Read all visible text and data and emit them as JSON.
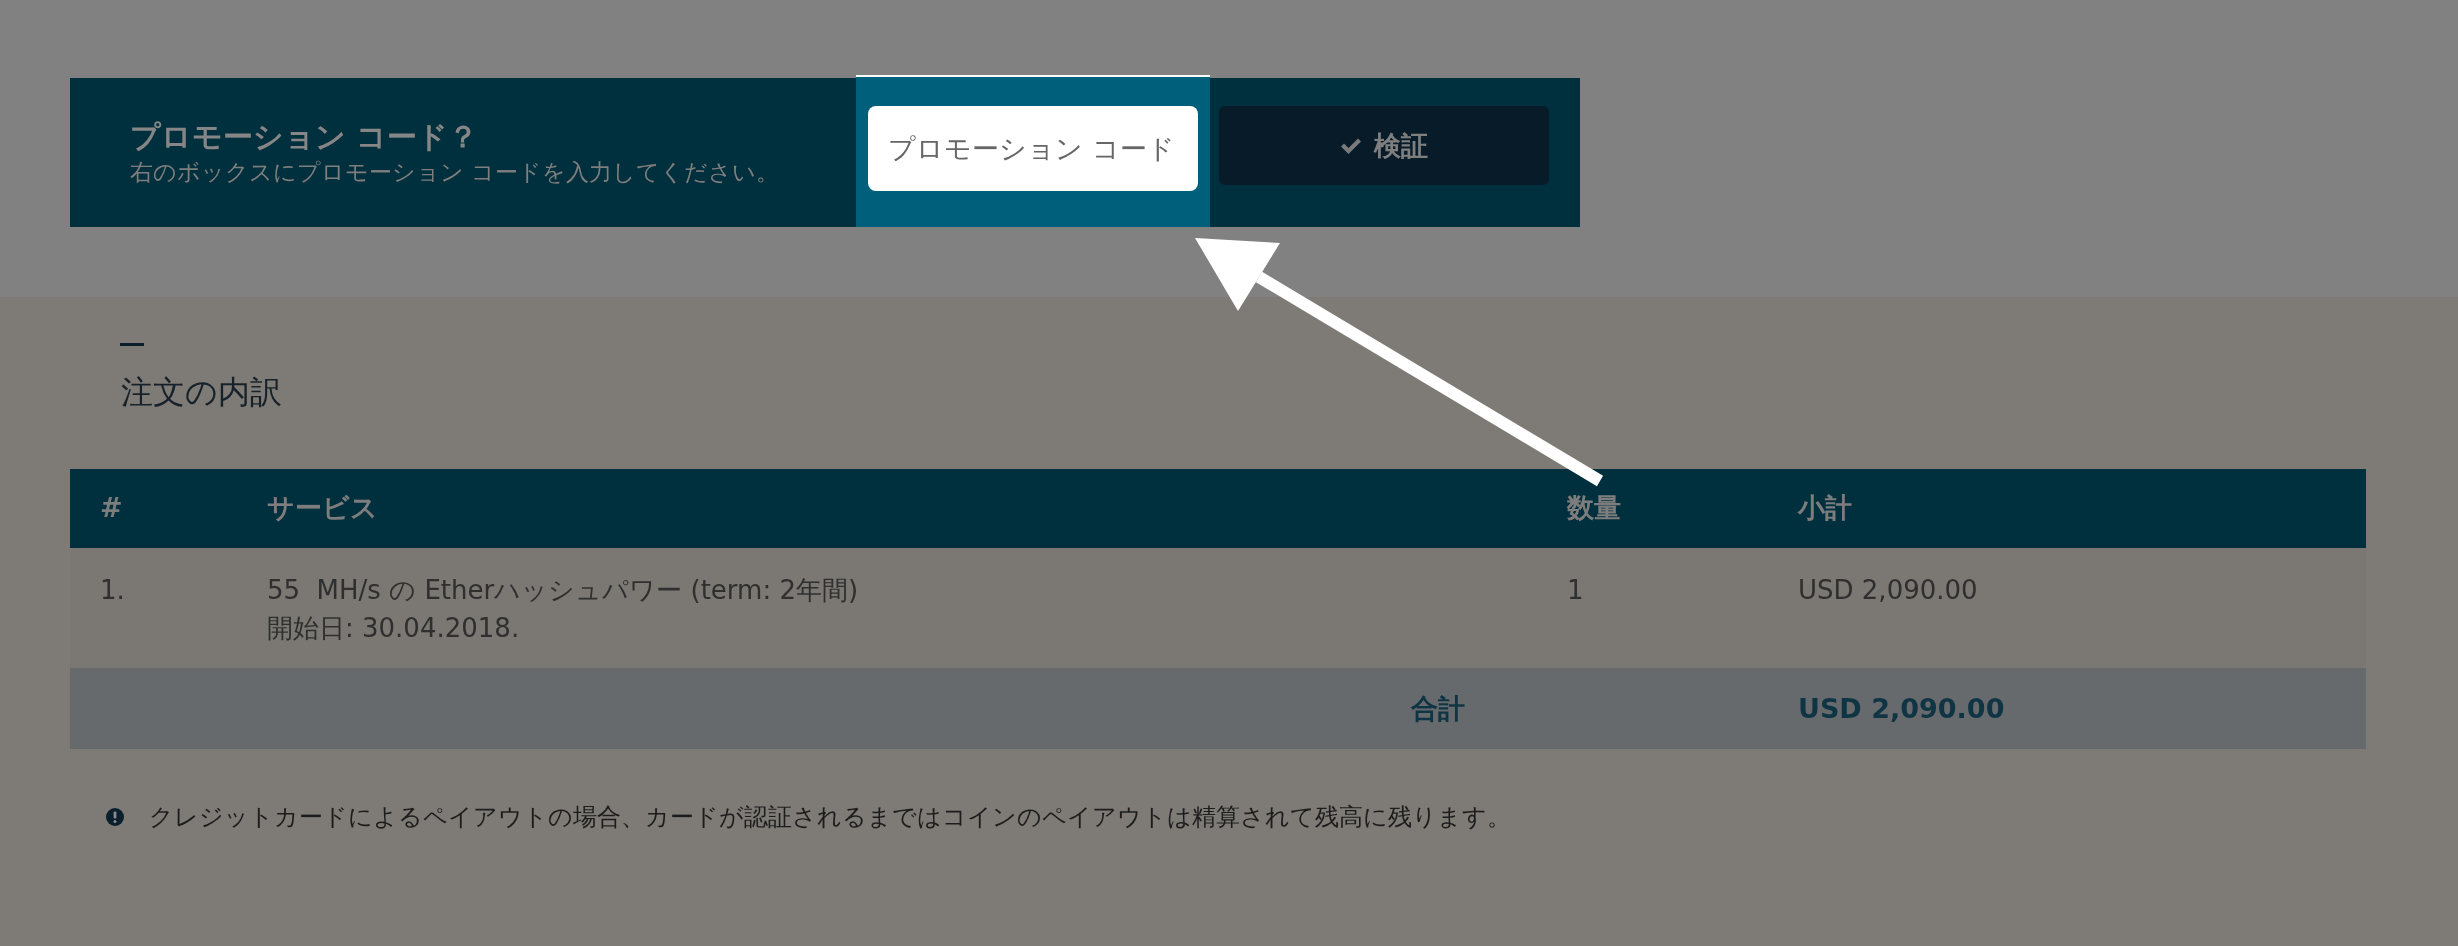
{
  "promo": {
    "title": "プロモーション コード？",
    "subtitle": "右のボックスにプロモーション コードを入力してください。",
    "code_field": {
      "placeholder": "プロモーション コード",
      "highlighted": true
    },
    "verify_button": {
      "label": "検証"
    }
  },
  "order": {
    "heading": "注文の内訳",
    "columns": [
      "#",
      "サービス",
      "数量",
      "小計"
    ],
    "rows": [
      {
        "number": "1.",
        "service": "55  MH/s の Etherハッシュパワー (term: 2年間)",
        "start_date": "開始日: 30.04.2018.",
        "quantity": "1",
        "subtotal": "USD 2,090.00"
      }
    ],
    "total": {
      "label": "合計",
      "amount": "USD 2,090.00"
    }
  },
  "note": {
    "text": "クレジットカードによるペイアウトの場合、カードが認証されるまではコインのペイアウトは精算されて残高に残ります。"
  }
}
